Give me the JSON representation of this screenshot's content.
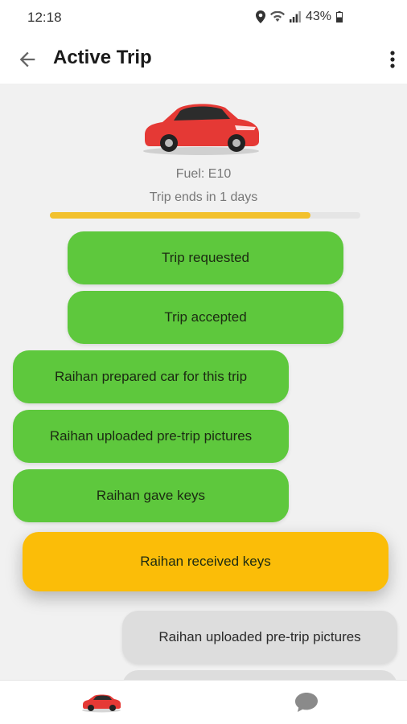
{
  "status_bar": {
    "time": "12:18",
    "battery": "43%"
  },
  "app_bar": {
    "title": "Active Trip",
    "icons": [
      "back-arrow-icon",
      "more-vert-icon"
    ]
  },
  "trip": {
    "fuel": "Fuel: E10",
    "ends": "Trip ends in 1 days",
    "progress": 0.84
  },
  "timeline": [
    {
      "label": "Trip requested",
      "state": "done"
    },
    {
      "label": "Trip accepted",
      "state": "done"
    },
    {
      "label": "Raihan prepared car for this trip",
      "state": "done"
    },
    {
      "label": "Raihan uploaded pre-trip pictures",
      "state": "done"
    },
    {
      "label": "Raihan gave keys",
      "state": "done"
    },
    {
      "label": "Raihan received keys",
      "state": "current"
    },
    {
      "label": "Raihan uploaded pre-trip pictures",
      "state": "pending"
    }
  ],
  "colors": {
    "done": "#5ec83d",
    "current": "#fbbd08",
    "pending": "#dddddd",
    "progress": "#f2c12e",
    "car": "#e53935"
  },
  "bottom_nav": {
    "items": [
      "car-icon",
      "chat-icon"
    ]
  }
}
